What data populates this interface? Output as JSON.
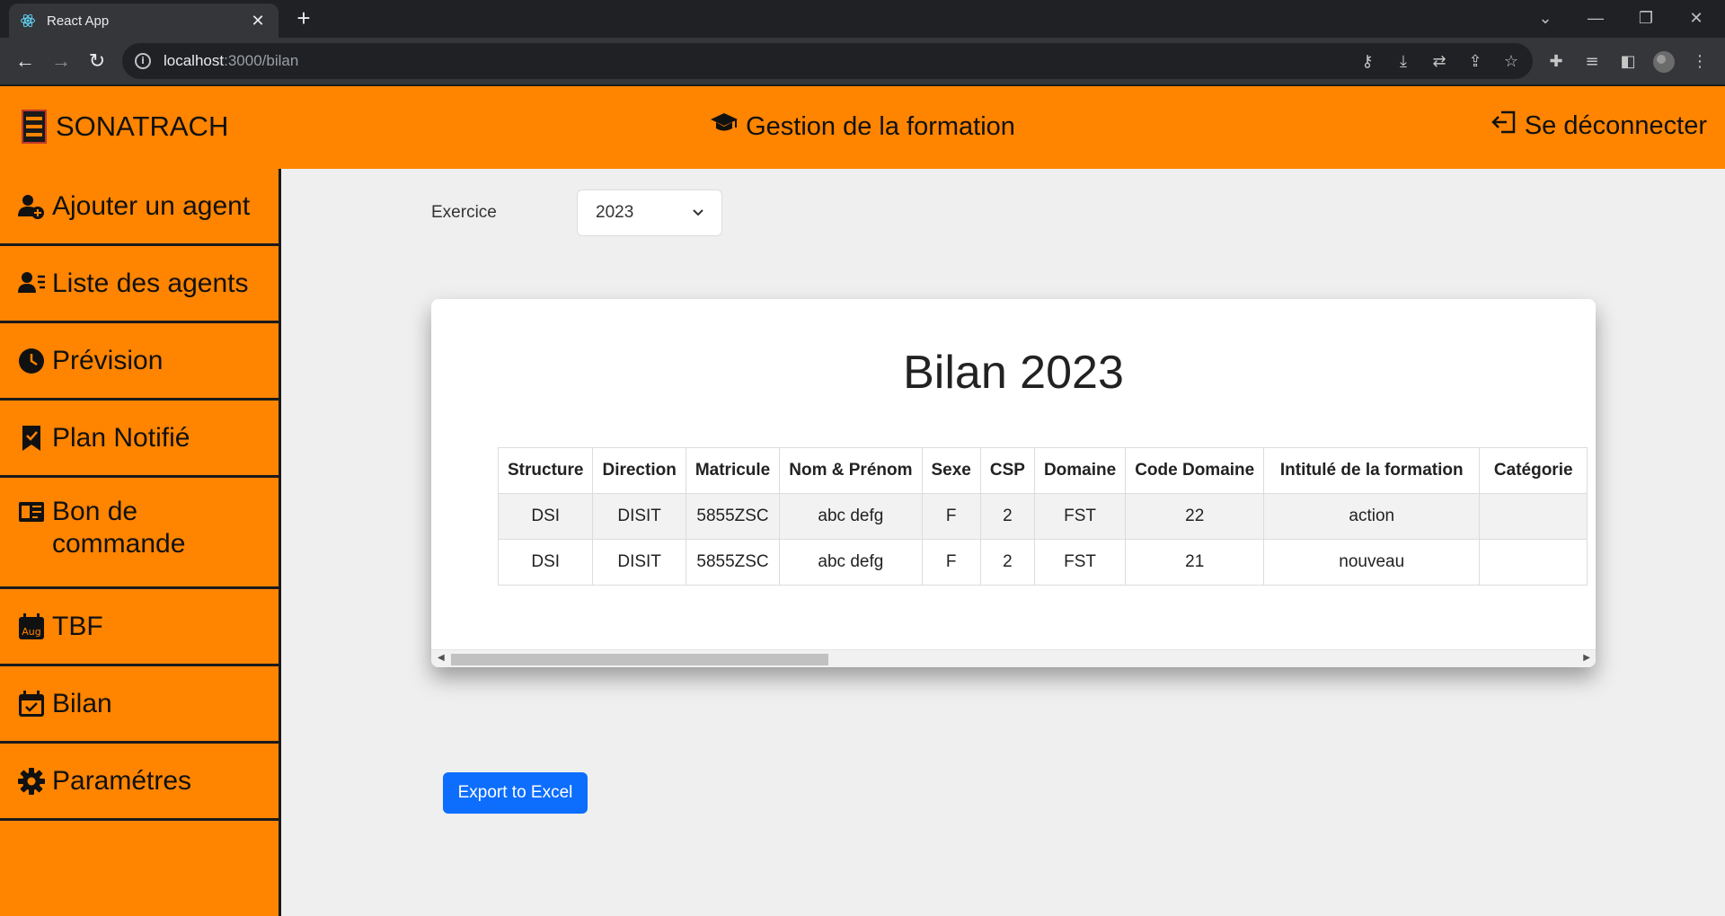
{
  "browser": {
    "tab_title": "React App",
    "url_host": "localhost",
    "url_path": ":3000/bilan"
  },
  "header": {
    "brand": "SONATRACH",
    "title": "Gestion de la formation",
    "logout": "Se déconnecter"
  },
  "sidebar": {
    "items": [
      {
        "label": "Ajouter un agent",
        "icon": "user-plus-icon"
      },
      {
        "label": "Liste des agents",
        "icon": "user-list-icon"
      },
      {
        "label": "Prévision",
        "icon": "clock-icon"
      },
      {
        "label": "Plan Notifié",
        "icon": "bookmark-check-icon"
      },
      {
        "label": "Bon de commande",
        "icon": "card-text-icon"
      },
      {
        "label": "TBF",
        "icon": "calendar-aug-icon"
      },
      {
        "label": "Bilan",
        "icon": "calendar-check-icon"
      },
      {
        "label": "Paramétres",
        "icon": "gear-icon"
      }
    ]
  },
  "filter": {
    "label": "Exercice",
    "selected": "2023"
  },
  "report": {
    "title": "Bilan 2023",
    "columns": [
      "Structure",
      "Direction",
      "Matricule",
      "Nom & Prénom",
      "Sexe",
      "CSP",
      "Domaine",
      "Code Domaine",
      "Intitulé de la formation",
      "Catégorie"
    ],
    "rows": [
      [
        "DSI",
        "DISIT",
        "5855ZSC",
        "abc defg",
        "F",
        "2",
        "FST",
        "22",
        "action",
        ""
      ],
      [
        "DSI",
        "DISIT",
        "5855ZSC",
        "abc defg",
        "F",
        "2",
        "FST",
        "21",
        "nouveau",
        ""
      ]
    ]
  },
  "export_label": "Export to Excel"
}
